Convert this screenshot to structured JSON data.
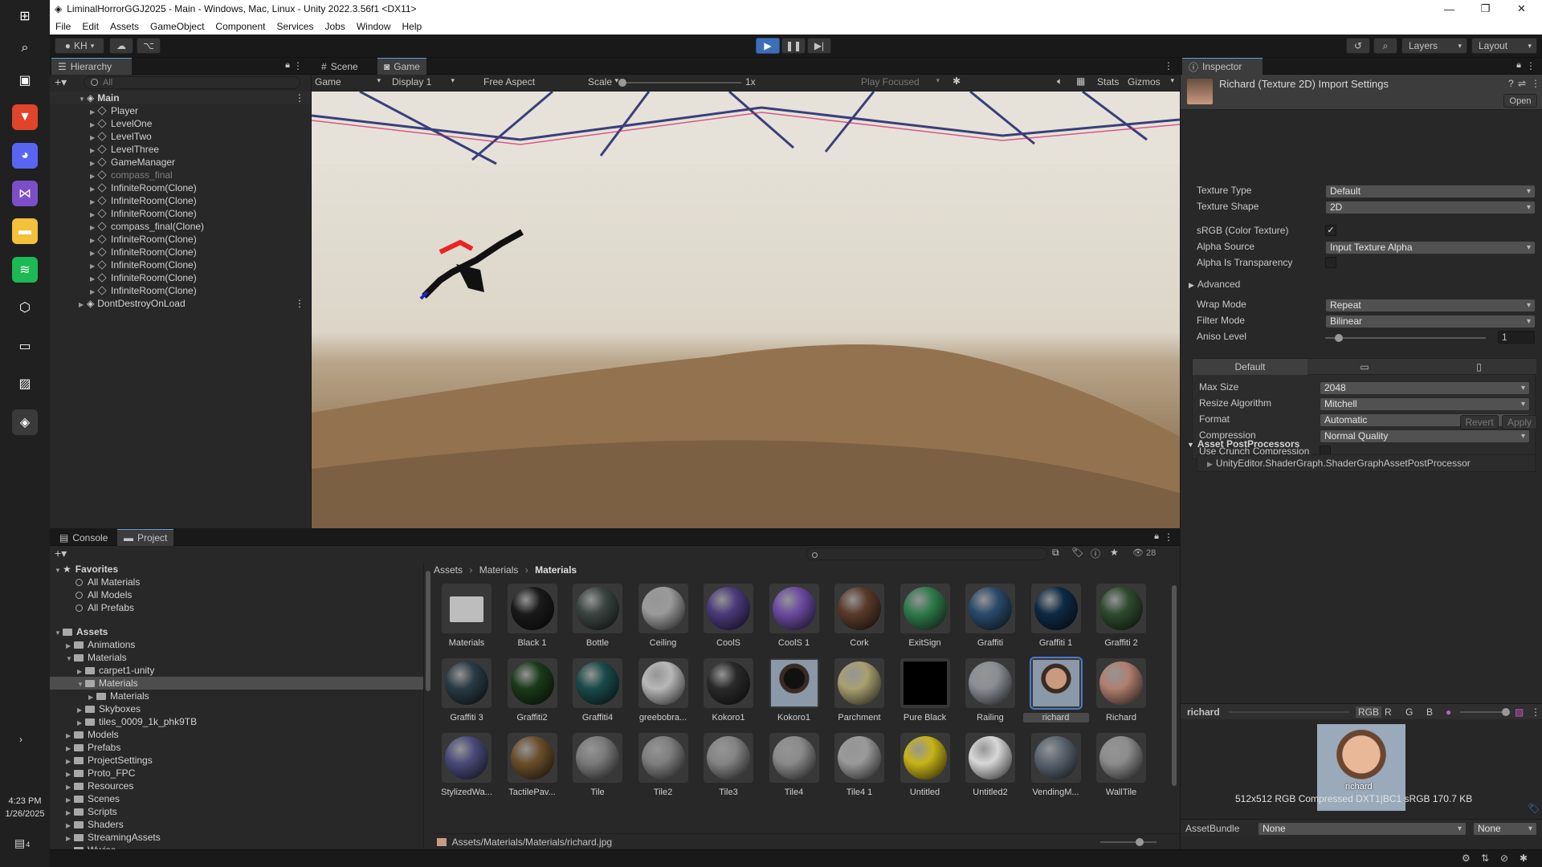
{
  "window": {
    "title": "LiminalHorrorGGJ2025 - Main - Windows, Mac, Linux - Unity 2022.3.56f1 <DX11>"
  },
  "menu": [
    "File",
    "Edit",
    "Assets",
    "GameObject",
    "Component",
    "Services",
    "Jobs",
    "Window",
    "Help"
  ],
  "toolbar": {
    "account": "KH",
    "layers": "Layers",
    "layout": "Layout"
  },
  "taskbar": {
    "time": "4:23 PM",
    "date": "1/26/2025",
    "notification_count": "4",
    "icons": [
      "windows-icon",
      "search-icon",
      "task-view-icon",
      "brave-icon",
      "discord-icon",
      "visual-studio-icon",
      "file-explorer-icon",
      "spotify-icon",
      "unity-hub-icon",
      "terminal-icon",
      "photos-icon",
      "unity-icon"
    ]
  },
  "hierarchy": {
    "tab": "Hierarchy",
    "search_placeholder": "All",
    "scene": "Main",
    "items": [
      {
        "name": "Player",
        "dim": false
      },
      {
        "name": "LevelOne",
        "dim": false
      },
      {
        "name": "LevelTwo",
        "dim": false
      },
      {
        "name": "LevelThree",
        "dim": false
      },
      {
        "name": "GameManager",
        "dim": false
      },
      {
        "name": "compass_final",
        "dim": true
      },
      {
        "name": "InfiniteRoom(Clone)",
        "dim": false
      },
      {
        "name": "InfiniteRoom(Clone)",
        "dim": false
      },
      {
        "name": "InfiniteRoom(Clone)",
        "dim": false
      },
      {
        "name": "compass_final(Clone)",
        "dim": false
      },
      {
        "name": "InfiniteRoom(Clone)",
        "dim": false
      },
      {
        "name": "InfiniteRoom(Clone)",
        "dim": false
      },
      {
        "name": "InfiniteRoom(Clone)",
        "dim": false
      },
      {
        "name": "InfiniteRoom(Clone)",
        "dim": false
      },
      {
        "name": "InfiniteRoom(Clone)",
        "dim": false
      }
    ],
    "dont_destroy": "DontDestroyOnLoad"
  },
  "game": {
    "tabs": [
      "Scene",
      "Game"
    ],
    "mode": "Game",
    "display": "Display 1",
    "aspect": "Free Aspect",
    "scale_label": "Scale",
    "scale_value": "1x",
    "play_focused": "Play Focused",
    "stats": "Stats",
    "gizmos": "Gizmos"
  },
  "inspector": {
    "tab": "Inspector",
    "title": "Richard (Texture 2D) Import Settings",
    "open": "Open",
    "props": [
      {
        "label": "Texture Type",
        "value": "Default"
      },
      {
        "label": "Texture Shape",
        "value": "2D"
      }
    ],
    "srgb_label": "sRGB (Color Texture)",
    "alpha_source_label": "Alpha Source",
    "alpha_source": "Input Texture Alpha",
    "alpha_transparency_label": "Alpha Is Transparency",
    "advanced": "Advanced",
    "wrap_label": "Wrap Mode",
    "wrap": "Repeat",
    "filter_label": "Filter Mode",
    "filter": "Bilinear",
    "aniso_label": "Aniso Level",
    "aniso": "1",
    "platform_tab": "Default",
    "max_size_label": "Max Size",
    "max_size": "2048",
    "resize_label": "Resize Algorithm",
    "resize": "Mitchell",
    "format_label": "Format",
    "format": "Automatic",
    "compression_label": "Compression",
    "compression": "Normal Quality",
    "crunch_label": "Use Crunch Compression",
    "revert": "Revert",
    "apply": "Apply",
    "postprocessors": "Asset PostProcessors",
    "postprocessor_item": "UnityEditor.ShaderGraph.ShaderGraphAssetPostProcessor",
    "preview_name": "richard",
    "channels": [
      "RGB",
      "R",
      "G",
      "B"
    ],
    "preview_label": "richard",
    "preview_info": "512x512  RGB Compressed DXT1|BC1 sRGB   170.7 KB",
    "assetbundle_label": "AssetBundle",
    "assetbundle": "None",
    "assetbundle_variant": "None"
  },
  "project": {
    "tabs": [
      "Console",
      "Project"
    ],
    "hidden_count": "28",
    "favorites": "Favorites",
    "fav_items": [
      "All Materials",
      "All Models",
      "All Prefabs"
    ],
    "assets_root": "Assets",
    "tree": [
      {
        "name": "Animations",
        "depth": 1,
        "exp": false
      },
      {
        "name": "Materials",
        "depth": 1,
        "exp": true
      },
      {
        "name": "carpet1-unity",
        "depth": 2,
        "exp": false
      },
      {
        "name": "Materials",
        "depth": 2,
        "exp": true,
        "selected": true
      },
      {
        "name": "Materials",
        "depth": 3,
        "exp": false
      },
      {
        "name": "Skyboxes",
        "depth": 2,
        "exp": false
      },
      {
        "name": "tiles_0009_1k_phk9TB",
        "depth": 2,
        "exp": false
      },
      {
        "name": "Models",
        "depth": 1,
        "exp": false
      },
      {
        "name": "Prefabs",
        "depth": 1,
        "exp": false
      },
      {
        "name": "ProjectSettings",
        "depth": 1,
        "exp": false
      },
      {
        "name": "Proto_FPC",
        "depth": 1,
        "exp": false
      },
      {
        "name": "Resources",
        "depth": 1,
        "exp": false
      },
      {
        "name": "Scenes",
        "depth": 1,
        "exp": false
      },
      {
        "name": "Scripts",
        "depth": 1,
        "exp": false
      },
      {
        "name": "Shaders",
        "depth": 1,
        "exp": false
      },
      {
        "name": "StreamingAssets",
        "depth": 1,
        "exp": false
      },
      {
        "name": "Wwise",
        "depth": 1,
        "exp": false
      }
    ],
    "breadcrumb": [
      "Assets",
      "Materials",
      "Materials"
    ],
    "assets": [
      {
        "name": "Materials",
        "kind": "folder",
        "color": "#bdbdbd"
      },
      {
        "name": "Black 1",
        "kind": "sphere",
        "color": "#1a1a1a"
      },
      {
        "name": "Bottle",
        "kind": "sphere",
        "color": "#3a4440"
      },
      {
        "name": "Ceiling",
        "kind": "sphere",
        "color": "#9a9a9a"
      },
      {
        "name": "CoolS",
        "kind": "sphere",
        "color": "#4b3a7a"
      },
      {
        "name": "CoolS 1",
        "kind": "sphere",
        "color": "#6a4aa0"
      },
      {
        "name": "Cork",
        "kind": "sphere",
        "color": "#5a3a2a"
      },
      {
        "name": "ExitSign",
        "kind": "sphere",
        "color": "#2f7a4a"
      },
      {
        "name": "Graffiti",
        "kind": "sphere",
        "color": "#2a4a6a"
      },
      {
        "name": "Graffiti 1",
        "kind": "sphere",
        "color": "#0e2a44"
      },
      {
        "name": "Graffiti 2",
        "kind": "sphere",
        "color": "#2e4a2e"
      },
      {
        "name": "Graffiti 3",
        "kind": "sphere",
        "color": "#2a3a44"
      },
      {
        "name": "Graffiti2",
        "kind": "sphere",
        "color": "#1a3a1a"
      },
      {
        "name": "Graffiti4",
        "kind": "sphere",
        "color": "#1a4a4a"
      },
      {
        "name": "greebobra...",
        "kind": "sphere",
        "color": "#b8b8b8"
      },
      {
        "name": "Kokoro1",
        "kind": "sphere",
        "color": "#2a2a2a"
      },
      {
        "name": "Kokoro1",
        "kind": "image",
        "color": "#111111"
      },
      {
        "name": "Parchment",
        "kind": "sphere",
        "color": "#a8a070"
      },
      {
        "name": "Pure Black",
        "kind": "square",
        "color": "#000000"
      },
      {
        "name": "Railing",
        "kind": "sphere",
        "color": "#8a8e94"
      },
      {
        "name": "richard",
        "kind": "image",
        "color": "#c89a80",
        "selected": true
      },
      {
        "name": "Richard",
        "kind": "sphere",
        "color": "#b08070"
      },
      {
        "name": "StylizedWa...",
        "kind": "sphere",
        "color": "#4a4a7a"
      },
      {
        "name": "TactilePav...",
        "kind": "sphere",
        "color": "#6a4e2a"
      },
      {
        "name": "Tile",
        "kind": "sphere",
        "color": "#7a7a7a"
      },
      {
        "name": "Tile2",
        "kind": "sphere",
        "color": "#7e7e7e"
      },
      {
        "name": "Tile3",
        "kind": "sphere",
        "color": "#848484"
      },
      {
        "name": "Tile4",
        "kind": "sphere",
        "color": "#8a8a8a"
      },
      {
        "name": "Tile4 1",
        "kind": "sphere",
        "color": "#9a9a9a"
      },
      {
        "name": "Untitled",
        "kind": "sphere",
        "color": "#c8b418"
      },
      {
        "name": "Untitled2",
        "kind": "sphere",
        "color": "#d8d8d8"
      },
      {
        "name": "VendingM...",
        "kind": "sphere",
        "color": "#5a6470"
      },
      {
        "name": "WallTile",
        "kind": "sphere",
        "color": "#8c8c8c"
      }
    ],
    "path": "Assets/Materials/Materials/richard.jpg"
  },
  "colors": {
    "accent": "#4a7ac8",
    "play_active": "#3d6fb6"
  }
}
